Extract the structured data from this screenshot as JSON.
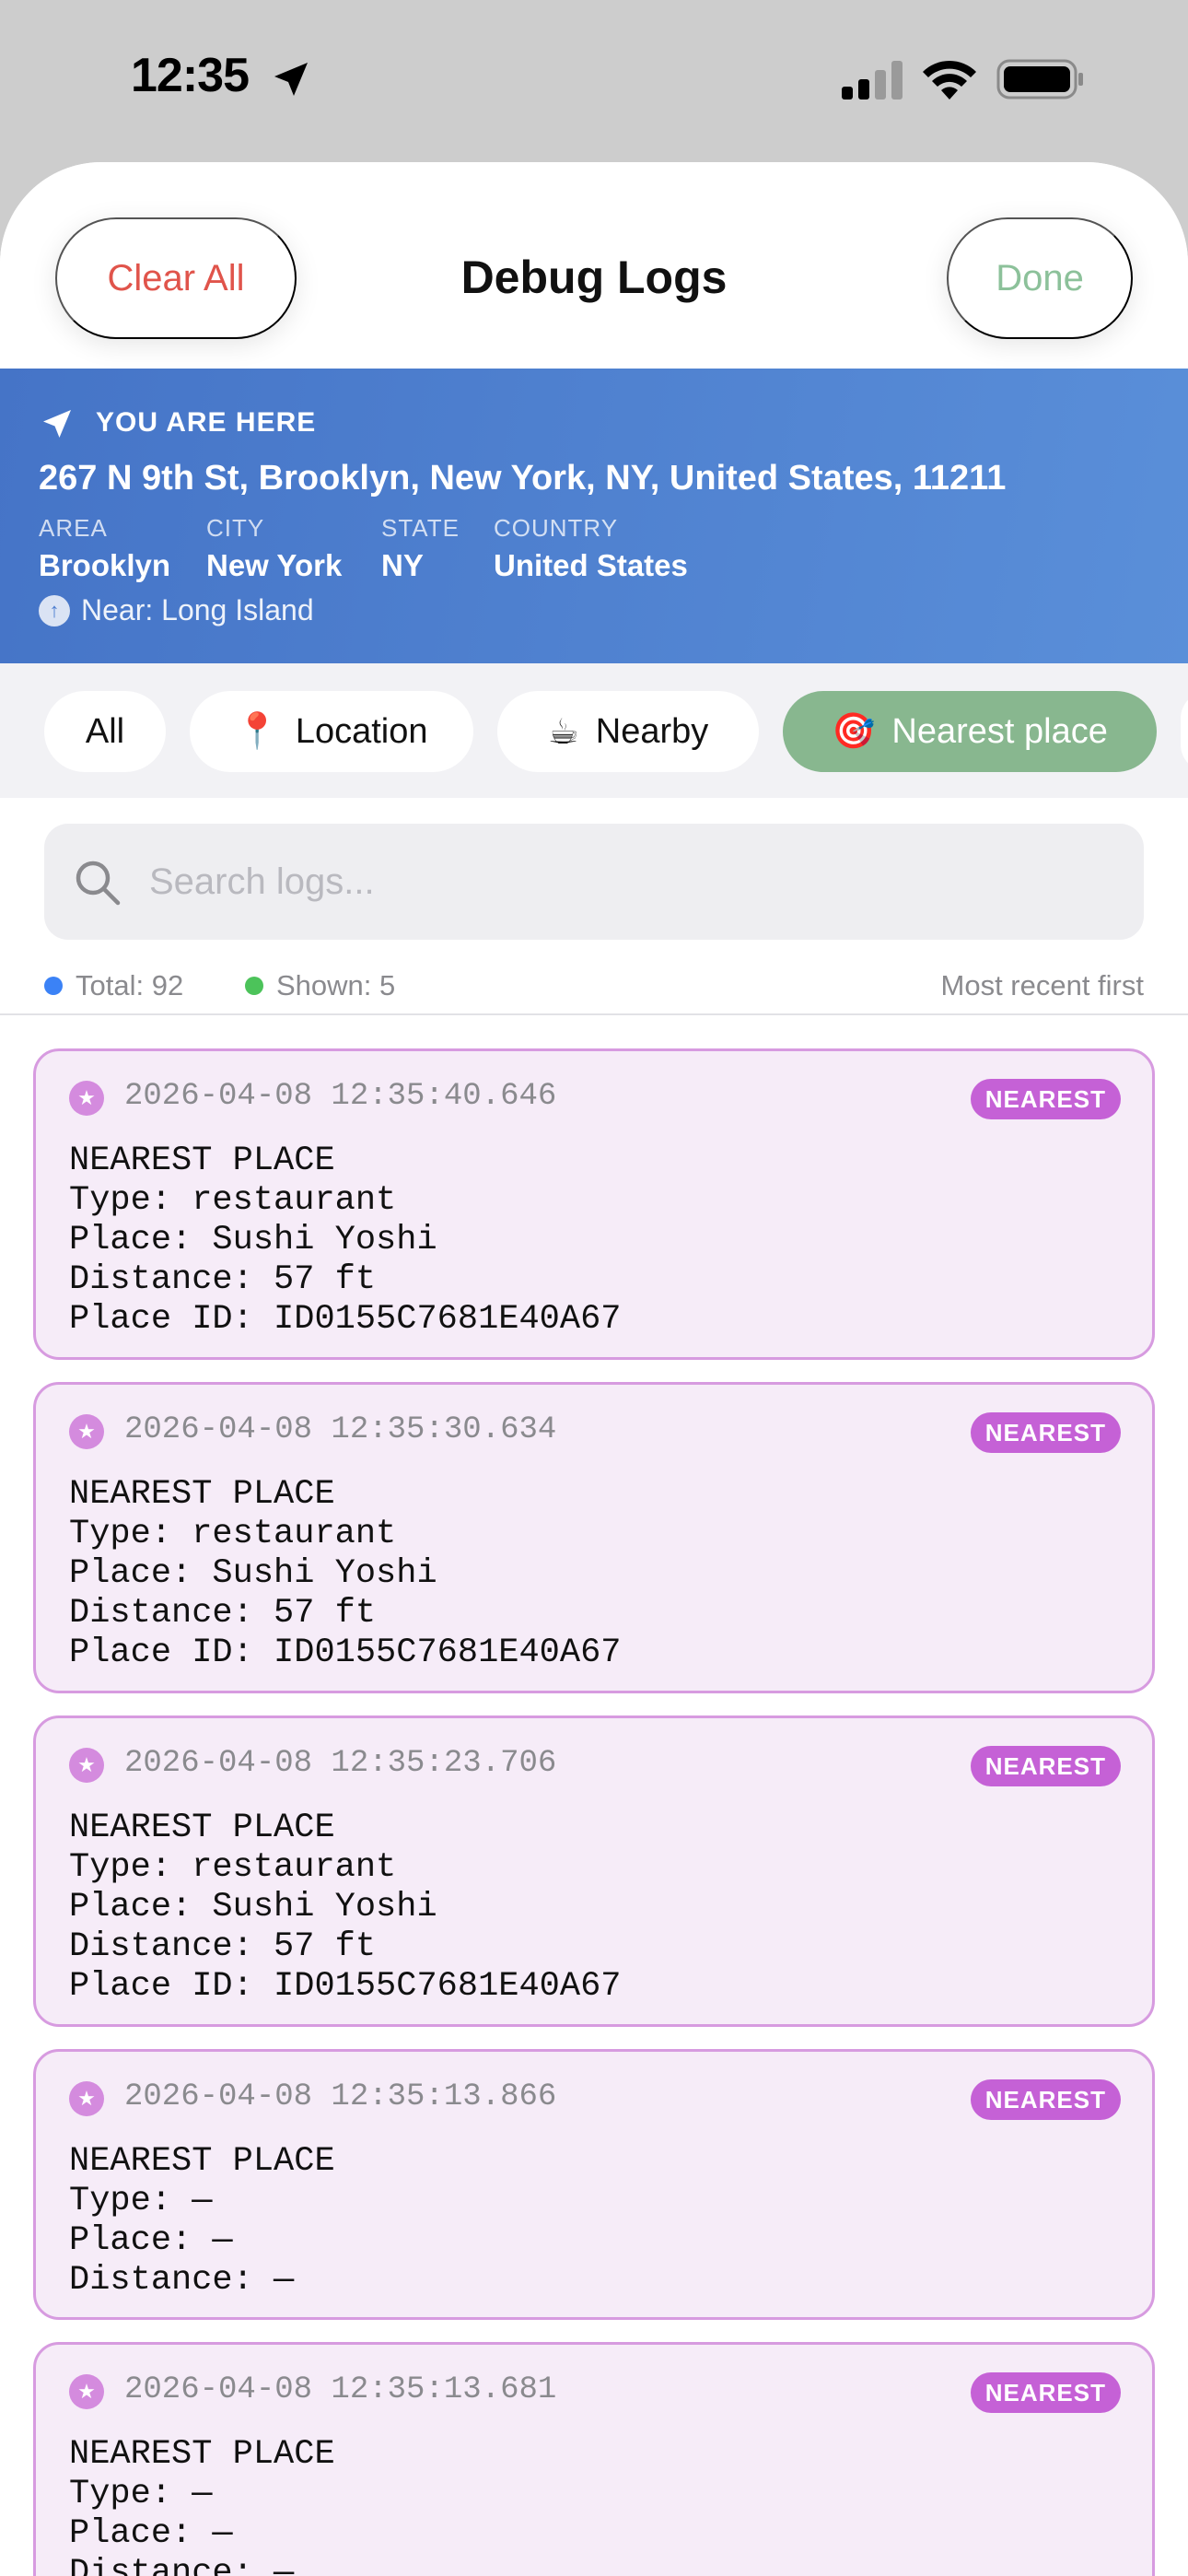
{
  "status_bar": {
    "time": "12:35"
  },
  "header": {
    "clear_label": "Clear All",
    "title": "Debug Logs",
    "done_label": "Done"
  },
  "location": {
    "label": "YOU ARE HERE",
    "address": "267 N 9th St, Brooklyn, New York, NY, United States, 11211",
    "fields": [
      {
        "key": "AREA",
        "value": "Brooklyn"
      },
      {
        "key": "CITY",
        "value": "New York"
      },
      {
        "key": "STATE",
        "value": "NY"
      },
      {
        "key": "COUNTRY",
        "value": "United States"
      }
    ],
    "near": "Near: Long Island"
  },
  "filters": [
    {
      "label": "All",
      "emoji": ""
    },
    {
      "label": "Location",
      "emoji": "📍"
    },
    {
      "label": "Nearby",
      "emoji": "☕"
    },
    {
      "label": "Nearest place",
      "emoji": "🎯"
    }
  ],
  "search": {
    "placeholder": "Search logs..."
  },
  "stats": {
    "total": "Total: 92",
    "shown": "Shown: 5",
    "sort": "Most recent first"
  },
  "colors": {
    "accent_green": "#88b78f",
    "clear_red": "#e0544b",
    "badge_purple": "#c561d6",
    "total_dot": "#3b82f6",
    "shown_dot": "#4cc35a"
  },
  "logs": [
    {
      "time": "2026-04-08 12:35:40.646",
      "badge": "NEAREST",
      "lines": [
        "NEAREST PLACE",
        "Type: restaurant",
        "Place: Sushi Yoshi",
        "Distance: 57 ft",
        "Place ID: ID0155C7681E40A67"
      ]
    },
    {
      "time": "2026-04-08 12:35:30.634",
      "badge": "NEAREST",
      "lines": [
        "NEAREST PLACE",
        "Type: restaurant",
        "Place: Sushi Yoshi",
        "Distance: 57 ft",
        "Place ID: ID0155C7681E40A67"
      ]
    },
    {
      "time": "2026-04-08 12:35:23.706",
      "badge": "NEAREST",
      "lines": [
        "NEAREST PLACE",
        "Type: restaurant",
        "Place: Sushi Yoshi",
        "Distance: 57 ft",
        "Place ID: ID0155C7681E40A67"
      ]
    },
    {
      "time": "2026-04-08 12:35:13.866",
      "badge": "NEAREST",
      "lines": [
        "NEAREST PLACE",
        "Type: —",
        "Place: —",
        "Distance: —"
      ]
    },
    {
      "time": "2026-04-08 12:35:13.681",
      "badge": "NEAREST",
      "lines": [
        "NEAREST PLACE",
        "Type: —",
        "Place: —",
        "Distance: —"
      ]
    }
  ]
}
